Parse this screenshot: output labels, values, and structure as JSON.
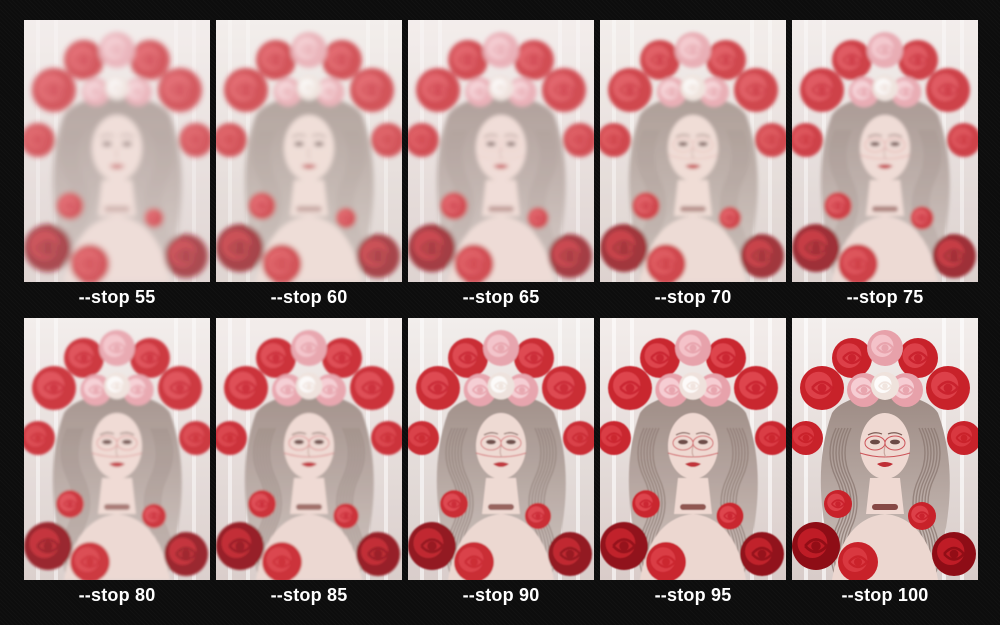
{
  "panels": [
    {
      "label": "--stop 55",
      "stop": 55
    },
    {
      "label": "--stop 60",
      "stop": 60
    },
    {
      "label": "--stop 65",
      "stop": 65
    },
    {
      "label": "--stop 70",
      "stop": 70
    },
    {
      "label": "--stop 75",
      "stop": 75
    },
    {
      "label": "--stop 80",
      "stop": 80
    },
    {
      "label": "--stop 85",
      "stop": 85
    },
    {
      "label": "--stop 90",
      "stop": 90
    },
    {
      "label": "--stop 95",
      "stop": 95
    },
    {
      "label": "--stop 100",
      "stop": 100
    }
  ],
  "palette": {
    "background": "#0d0d0d",
    "caption": "#ffffff",
    "rose_red": "#c8202a",
    "rose_deep": "#8e0f17",
    "rose_pink": "#e7a1aa",
    "rose_cream": "#efe2dc",
    "skin": "#efd9d2",
    "hair": "#b9aaa3",
    "lips": "#bf2d35",
    "backdrop": "#e8e1de"
  }
}
